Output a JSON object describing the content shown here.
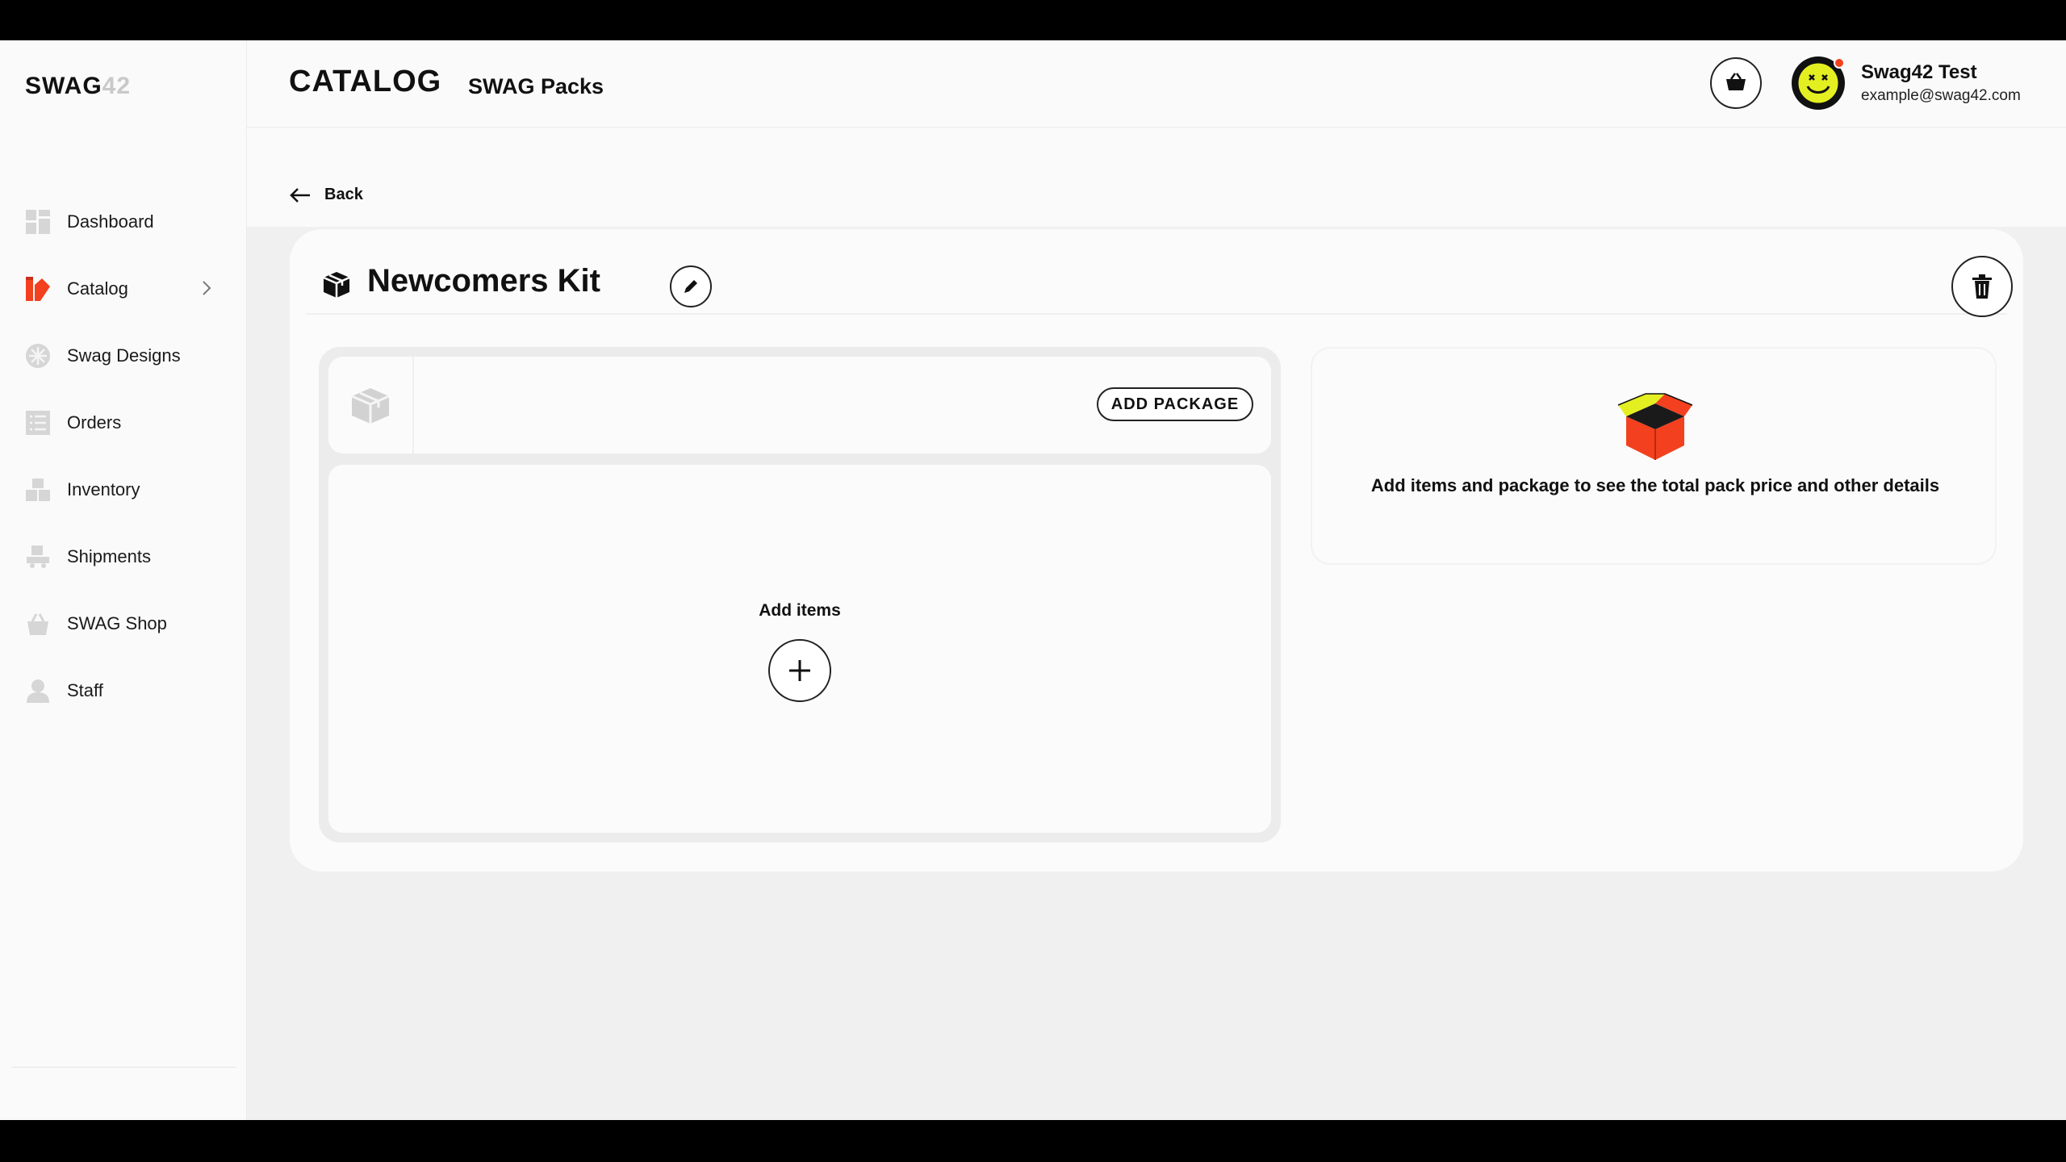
{
  "logo": {
    "main": "SWAG",
    "num": "42"
  },
  "sidebar": {
    "items": [
      {
        "label": "Dashboard",
        "icon": "dashboard-icon"
      },
      {
        "label": "Catalog",
        "icon": "catalog-icon"
      },
      {
        "label": "Swag Designs",
        "icon": "swag-designs-icon"
      },
      {
        "label": "Orders",
        "icon": "orders-icon"
      },
      {
        "label": "Inventory",
        "icon": "inventory-icon"
      },
      {
        "label": "Shipments",
        "icon": "shipments-icon"
      },
      {
        "label": "SWAG Shop",
        "icon": "swag-shop-icon"
      },
      {
        "label": "Staff",
        "icon": "staff-icon"
      }
    ],
    "active_index": 1
  },
  "header": {
    "title": "CATALOG",
    "subtitle": "SWAG Packs",
    "user": {
      "name": "Swag42 Test",
      "email": "example@swag42.com"
    }
  },
  "backbar": {
    "label": "Back"
  },
  "pack": {
    "name": "Newcomers Kit",
    "add_package_label": "ADD PACKAGE",
    "add_items_label": "Add items",
    "summary_placeholder": "Add items and package to see the total pack price and other details"
  },
  "colors": {
    "accent": "#f3401f",
    "accent_yellow": "#e4ef21",
    "background": "#f0f0f0",
    "surface": "#fbfbfb"
  }
}
